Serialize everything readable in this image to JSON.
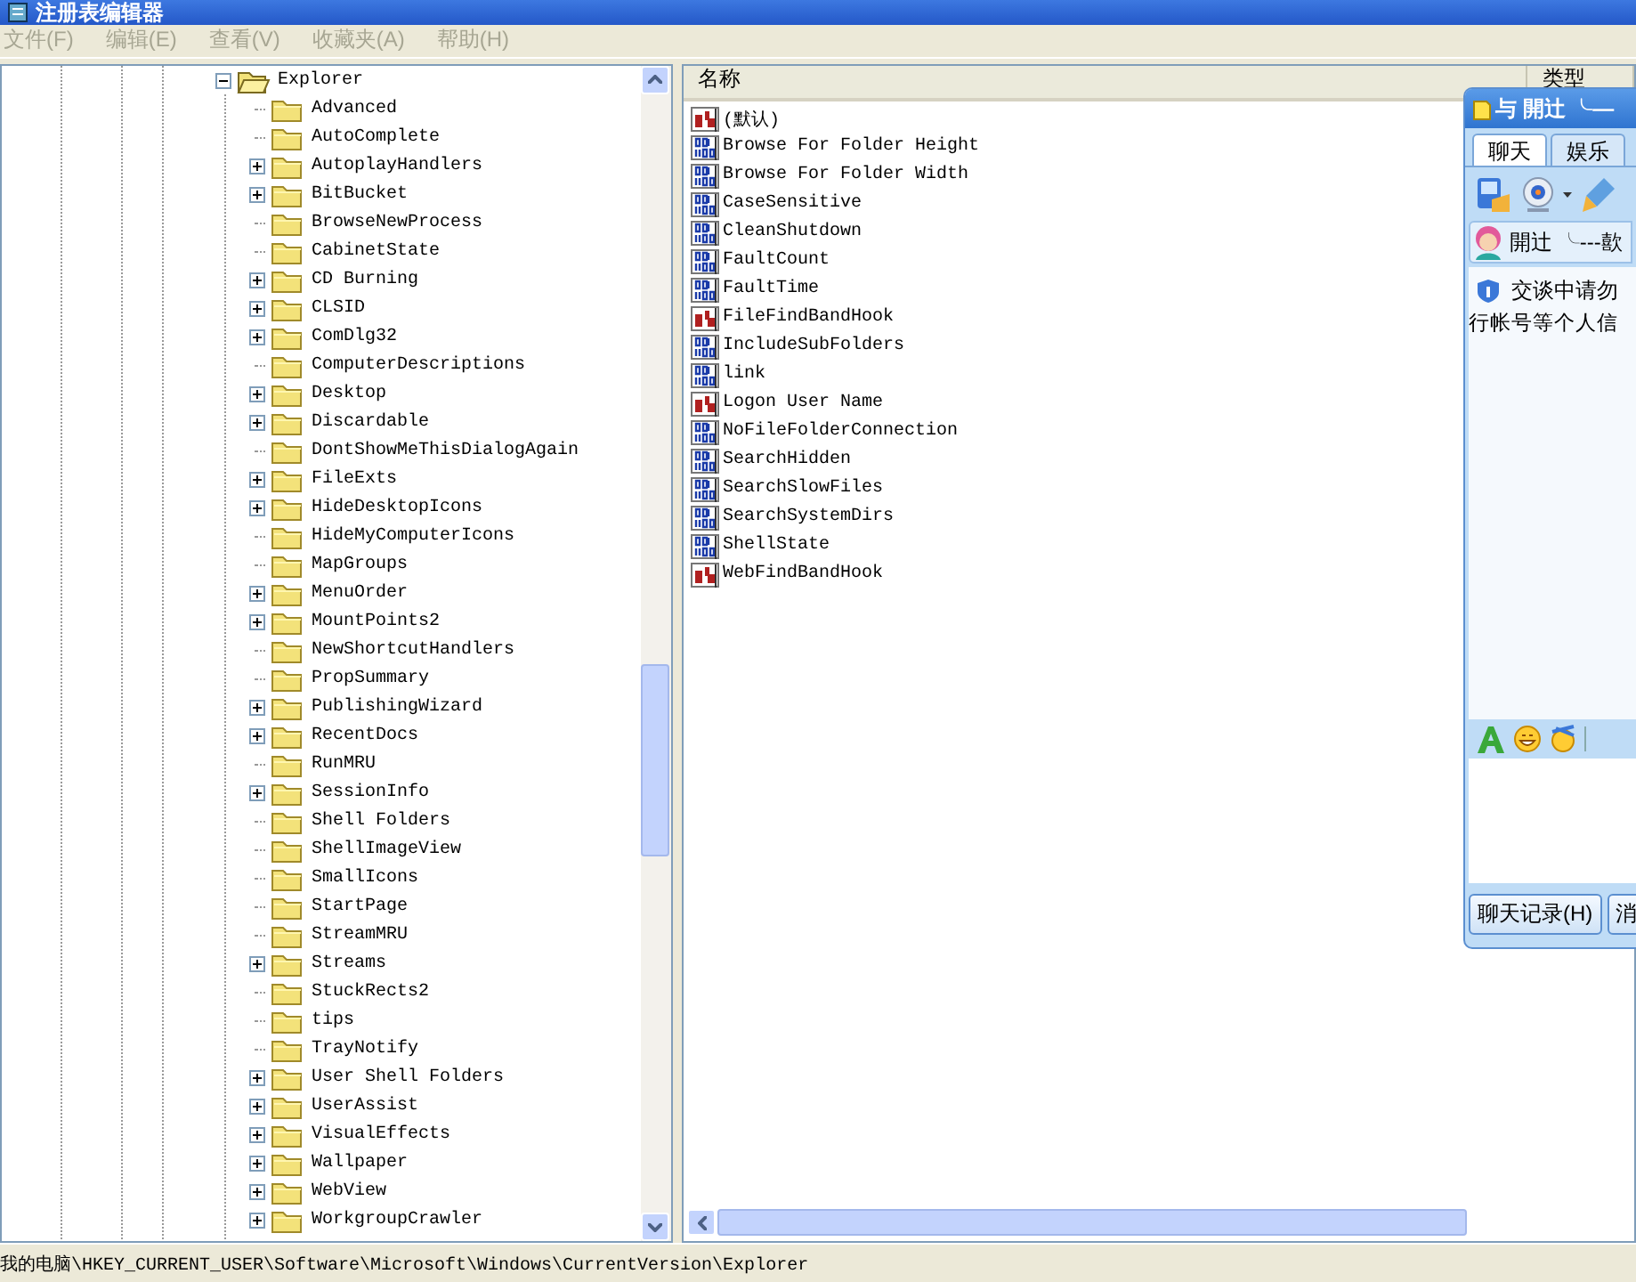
{
  "window": {
    "title": "注册表编辑器"
  },
  "menu": [
    {
      "label": "文件(F)",
      "disabled": true
    },
    {
      "label": "编辑(E)",
      "disabled": true
    },
    {
      "label": "查看(V)",
      "disabled": true
    },
    {
      "label": "收藏夹(A)",
      "disabled": true
    },
    {
      "label": "帮助(H)",
      "disabled": true
    }
  ],
  "tree": {
    "label": "Explorer",
    "expanded": true,
    "children": [
      {
        "label": "Advanced",
        "expandable": false
      },
      {
        "label": "AutoComplete",
        "expandable": false
      },
      {
        "label": "AutoplayHandlers",
        "expandable": true
      },
      {
        "label": "BitBucket",
        "expandable": true
      },
      {
        "label": "BrowseNewProcess",
        "expandable": false
      },
      {
        "label": "CabinetState",
        "expandable": false
      },
      {
        "label": "CD Burning",
        "expandable": true
      },
      {
        "label": "CLSID",
        "expandable": true
      },
      {
        "label": "ComDlg32",
        "expandable": true
      },
      {
        "label": "ComputerDescriptions",
        "expandable": false
      },
      {
        "label": "Desktop",
        "expandable": true
      },
      {
        "label": "Discardable",
        "expandable": true
      },
      {
        "label": "DontShowMeThisDialogAgain",
        "expandable": false
      },
      {
        "label": "FileExts",
        "expandable": true
      },
      {
        "label": "HideDesktopIcons",
        "expandable": true
      },
      {
        "label": "HideMyComputerIcons",
        "expandable": false
      },
      {
        "label": "MapGroups",
        "expandable": false
      },
      {
        "label": "MenuOrder",
        "expandable": true
      },
      {
        "label": "MountPoints2",
        "expandable": true
      },
      {
        "label": "NewShortcutHandlers",
        "expandable": false
      },
      {
        "label": "PropSummary",
        "expandable": false
      },
      {
        "label": "PublishingWizard",
        "expandable": true
      },
      {
        "label": "RecentDocs",
        "expandable": true
      },
      {
        "label": "RunMRU",
        "expandable": false
      },
      {
        "label": "SessionInfo",
        "expandable": true
      },
      {
        "label": "Shell Folders",
        "expandable": false
      },
      {
        "label": "ShellImageView",
        "expandable": false
      },
      {
        "label": "SmallIcons",
        "expandable": false
      },
      {
        "label": "StartPage",
        "expandable": false
      },
      {
        "label": "StreamMRU",
        "expandable": false
      },
      {
        "label": "Streams",
        "expandable": true
      },
      {
        "label": "StuckRects2",
        "expandable": false
      },
      {
        "label": "tips",
        "expandable": false
      },
      {
        "label": "TrayNotify",
        "expandable": false
      },
      {
        "label": "User Shell Folders",
        "expandable": true
      },
      {
        "label": "UserAssist",
        "expandable": true
      },
      {
        "label": "VisualEffects",
        "expandable": true
      },
      {
        "label": "Wallpaper",
        "expandable": true
      },
      {
        "label": "WebView",
        "expandable": true
      },
      {
        "label": "WorkgroupCrawler",
        "expandable": true
      }
    ]
  },
  "values": {
    "columns": [
      "名称",
      "类型"
    ],
    "rows": [
      {
        "name": "(默认)",
        "kind": "string"
      },
      {
        "name": "Browse For Folder Height",
        "kind": "binary"
      },
      {
        "name": "Browse For Folder Width",
        "kind": "binary"
      },
      {
        "name": "CaseSensitive",
        "kind": "binary"
      },
      {
        "name": "CleanShutdown",
        "kind": "binary"
      },
      {
        "name": "FaultCount",
        "kind": "binary"
      },
      {
        "name": "FaultTime",
        "kind": "binary"
      },
      {
        "name": "FileFindBandHook",
        "kind": "string"
      },
      {
        "name": "IncludeSubFolders",
        "kind": "binary"
      },
      {
        "name": "link",
        "kind": "binary"
      },
      {
        "name": "Logon User Name",
        "kind": "string"
      },
      {
        "name": "NoFileFolderConnection",
        "kind": "binary"
      },
      {
        "name": "SearchHidden",
        "kind": "binary"
      },
      {
        "name": "SearchSlowFiles",
        "kind": "binary"
      },
      {
        "name": "SearchSystemDirs",
        "kind": "binary"
      },
      {
        "name": "ShellState",
        "kind": "binary"
      },
      {
        "name": "WebFindBandHook",
        "kind": "string"
      }
    ]
  },
  "status_bar": "我的电脑\\HKEY_CURRENT_USER\\Software\\Microsoft\\Windows\\CurrentVersion\\Explorer",
  "chat_window": {
    "title": "与 開辻 ╰—",
    "tabs": [
      {
        "label": "聊天",
        "selected": true
      },
      {
        "label": "娱乐",
        "selected": false
      }
    ],
    "contact": "開辻 ╰---歖",
    "notice": [
      "交谈中请勿",
      "行帐号等个人信"
    ],
    "buttons": [
      "聊天记录(H)",
      "消"
    ]
  }
}
